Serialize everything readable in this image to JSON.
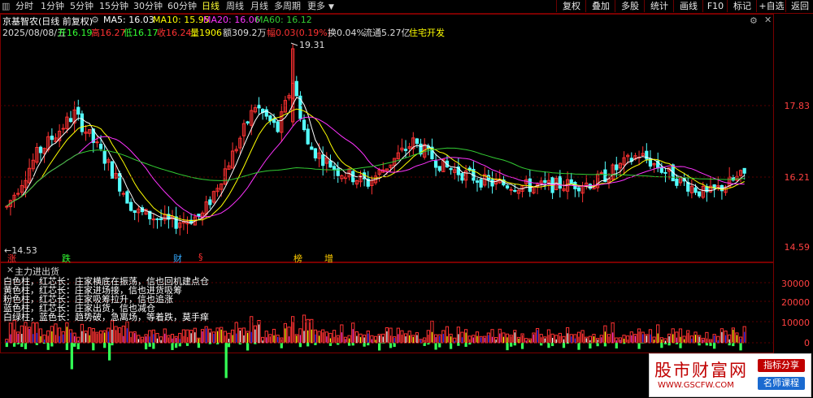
{
  "toolbar": {
    "tabs": [
      "分时",
      "1分钟",
      "5分钟",
      "15分钟",
      "30分钟",
      "60分钟",
      "日线",
      "周线",
      "月线",
      "多周期",
      "更多"
    ],
    "active_index": 6,
    "right_buttons": [
      "复权",
      "叠加",
      "多股",
      "统计",
      "画线",
      "F10",
      "标记",
      "+自选",
      "返回"
    ]
  },
  "header": {
    "stock": "京基智农(日线 前复权)",
    "ma5": "MA5: 16.03",
    "ma10": "MA10: 15.95",
    "ma20": "MA20: 16.06",
    "ma60": "MA60: 16.12",
    "date": "2025/08/08/五",
    "open": "开16.19",
    "high": "高16.27",
    "low": "低16.17",
    "close": "收16.24",
    "volume": "量1906",
    "amount": "额309.2万",
    "change": "幅0.03(0.19%)",
    "turnover": "换0.04%",
    "float": "流通5.27亿",
    "sector": "住宅开发"
  },
  "price_axis": [
    "17.83",
    "16.21",
    "14.59"
  ],
  "price_annotations": {
    "high_mark": "19.31",
    "low_mark": "←14.53"
  },
  "events": [
    {
      "label": "涨",
      "color": "#ff3030"
    },
    {
      "label": "跌",
      "color": "#33ff33"
    },
    {
      "label": "财",
      "color": "#33aaff"
    },
    {
      "label": "§",
      "color": "#ff3030"
    },
    {
      "label": "榜",
      "color": "#ffcc00"
    },
    {
      "label": "增",
      "color": "#ffcc00"
    }
  ],
  "indicator": {
    "title": "主力进出货",
    "notes": [
      "白色柱，红芯长：庄家横底在振荡，信也回机建点仓",
      "黄色柱，红芯长：庄家进场接，信也进货吸筹",
      "粉色柱，红芯长：庄家吸筹拉升，信也追涨",
      "蓝色柱，红芯长：庄家出货，信也减仓",
      "白绿柱，蓝色长：趋势破，急离场，等着跌，莫手痒"
    ],
    "axis": [
      "30000",
      "20000",
      "10000",
      "0"
    ]
  },
  "watermark": {
    "title": "股市财富网",
    "url": "WWW.GSCFW.COM",
    "badge1": "指标分享",
    "badge2": "名师课程"
  },
  "colors": {
    "up": "#ff3232",
    "down": "#54ffff",
    "ma5": "#ffffff",
    "ma10": "#ffff00",
    "ma20": "#ff33ff",
    "ma60": "#33cc33",
    "border": "#7a0000"
  }
}
